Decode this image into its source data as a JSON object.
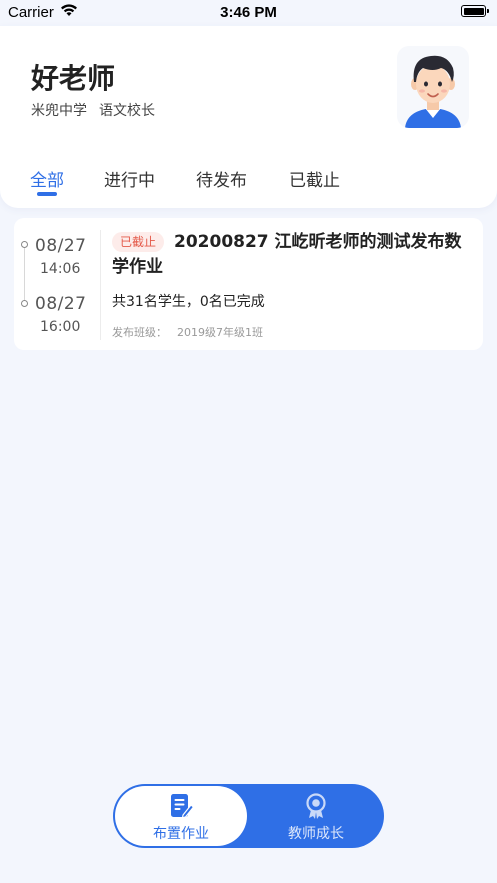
{
  "status_bar": {
    "carrier": "Carrier",
    "time": "3:46 PM"
  },
  "profile": {
    "name": "好老师",
    "school": "米兜中学",
    "role": "语文校长"
  },
  "tabs": [
    {
      "label": "全部",
      "active": true
    },
    {
      "label": "进行中",
      "active": false
    },
    {
      "label": "待发布",
      "active": false
    },
    {
      "label": "已截止",
      "active": false
    }
  ],
  "tasks": [
    {
      "start_date": "08/27",
      "start_time": "14:06",
      "end_date": "08/27",
      "end_time": "16:00",
      "status_badge": "已截止",
      "title": "20200827 江屹昕老师的测试发布数学作业",
      "progress": "共31名学生，0名已完成",
      "class_label": "发布班级：",
      "class_value": "2019级7年级1班"
    }
  ],
  "bottom_nav": [
    {
      "label": "布置作业",
      "icon": "assignment-edit-icon",
      "active": true
    },
    {
      "label": "教师成长",
      "icon": "award-badge-icon",
      "active": false
    }
  ],
  "colors": {
    "accent": "#2f6fe6",
    "background": "#f3f6fd",
    "badge_bg": "#fdecea",
    "badge_text": "#e45a4a"
  }
}
